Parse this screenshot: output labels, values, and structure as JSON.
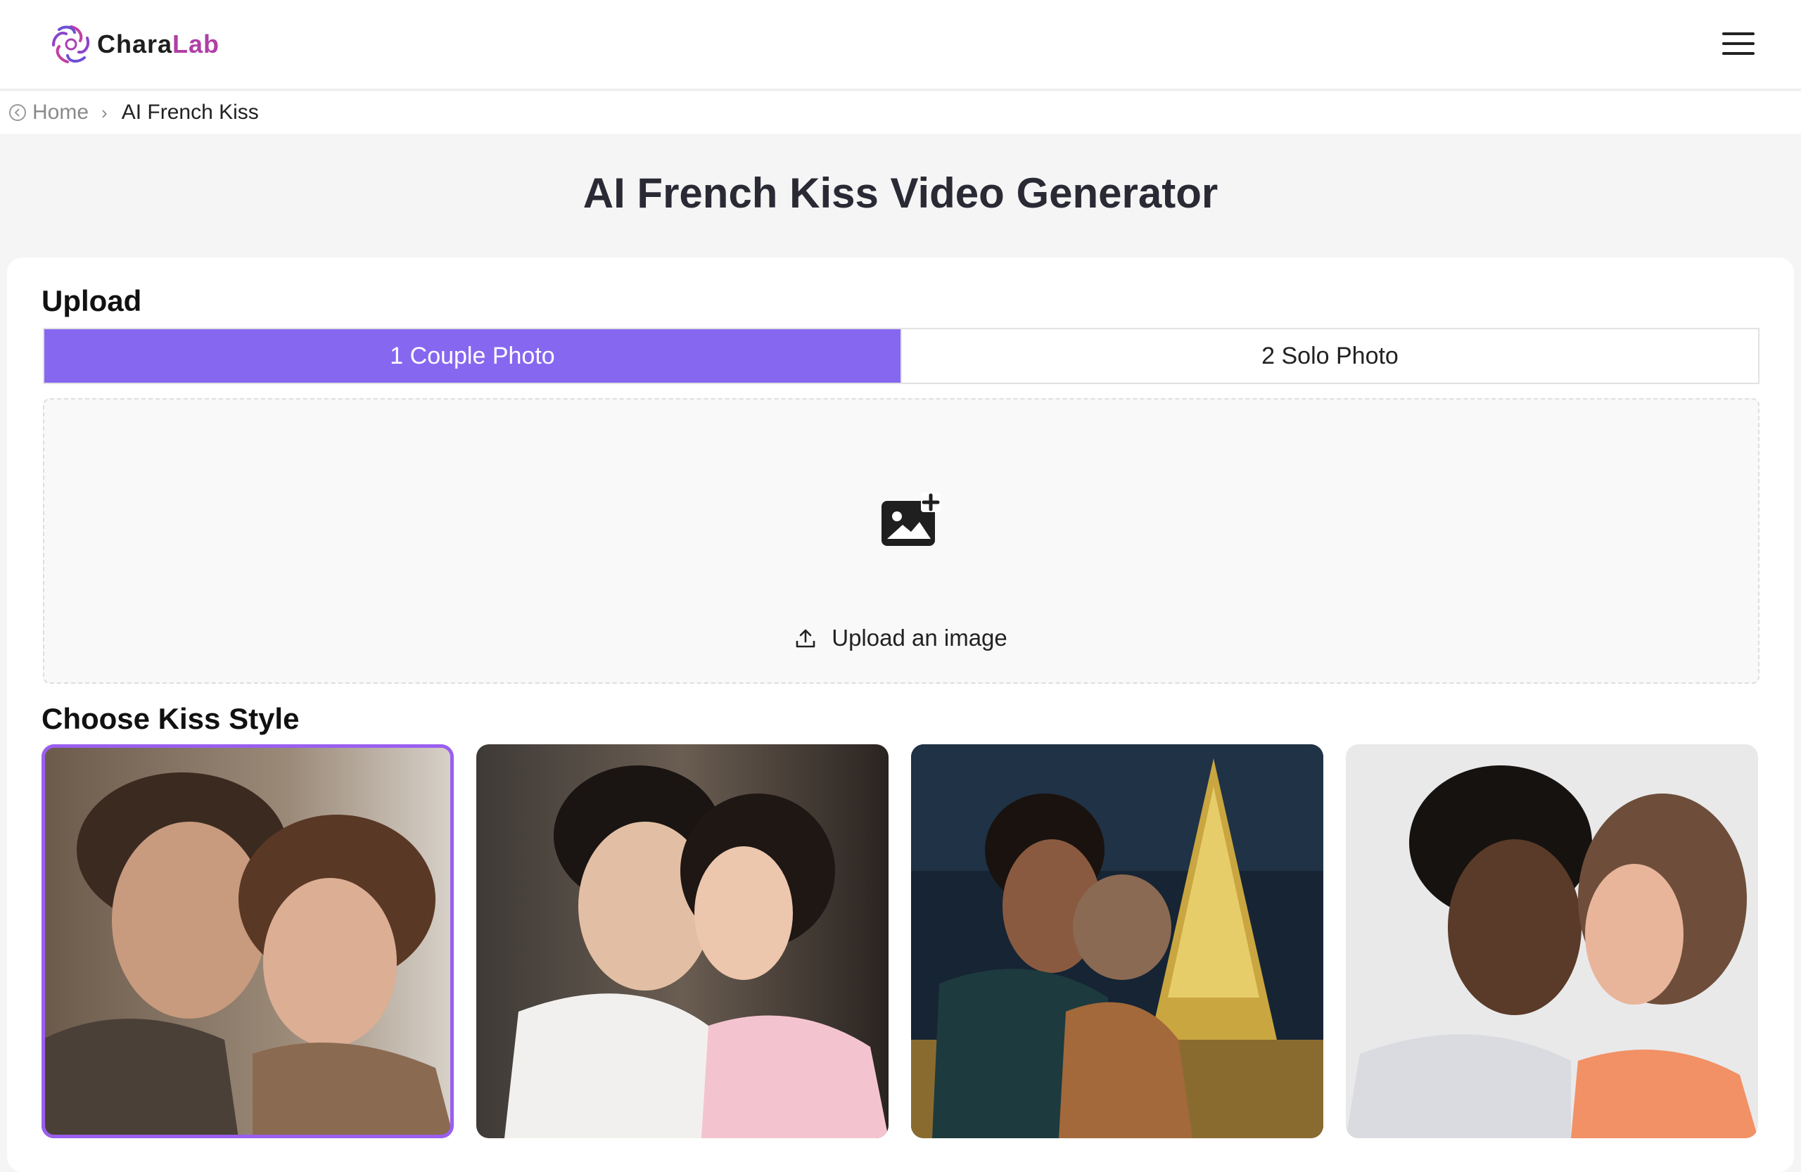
{
  "header": {
    "logo_primary": "Chara",
    "logo_accent": "Lab",
    "menu_icon": "hamburger-icon"
  },
  "breadcrumb": {
    "home_label": "Home",
    "current_label": "AI French Kiss"
  },
  "page": {
    "title": "AI French Kiss Video Generator"
  },
  "upload": {
    "section_label": "Upload",
    "tabs": [
      {
        "label": "1 Couple Photo",
        "active": true
      },
      {
        "label": "2 Solo Photo",
        "active": false
      }
    ],
    "dropzone_label": "Upload an image",
    "dropzone_icon": "add-image-icon",
    "upload_icon": "upload-icon"
  },
  "kiss_style": {
    "section_label": "Choose Kiss Style",
    "selected_index": 0,
    "options": [
      {
        "name": "style-1"
      },
      {
        "name": "style-2"
      },
      {
        "name": "style-3"
      },
      {
        "name": "style-4"
      }
    ]
  },
  "colors": {
    "accent": "#8667f0",
    "selected_border": "#9a5ff0",
    "logo_accent": "#b03fa6"
  }
}
